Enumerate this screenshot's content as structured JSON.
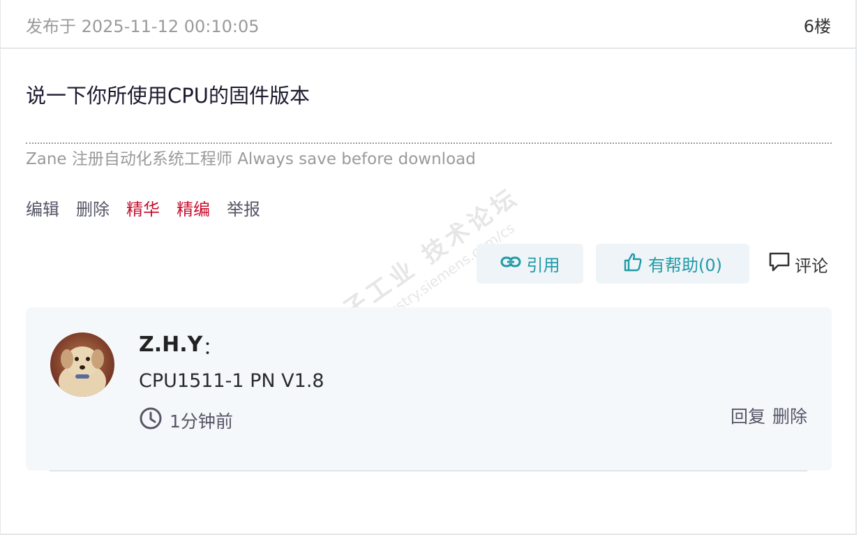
{
  "header": {
    "post_time": "发布于 2025-11-12 00:10:05",
    "floor": "6楼"
  },
  "post": {
    "body": "说一下你所使用CPU的固件版本",
    "signature": "Zane 注册自动化系统工程师 Always save before download"
  },
  "admin_actions": {
    "edit": "编辑",
    "delete": "删除",
    "featured": "精华",
    "edited_pick": "精编",
    "report": "举报"
  },
  "buttons": {
    "quote": "引用",
    "helpful": "有帮助(0)",
    "comment": "评论"
  },
  "comment": {
    "author": "Z.H.Y",
    "colon": "：",
    "text": "CPU1511-1 PN V1.8",
    "time": "1分钟前",
    "reply": "回复",
    "delete": "删除"
  },
  "watermark": {
    "line1": "西门子工业 技术论坛",
    "line2": "support.industry.siemens.com/cs"
  },
  "colors": {
    "accent": "#1f9aa6",
    "red": "#c8102e",
    "muted": "#9a9a9a",
    "button_bg": "#eef4f7",
    "comment_bg": "#f5f8fa"
  },
  "icons": [
    "link-icon",
    "thumbs-up-icon",
    "speech-bubble-icon",
    "clock-icon"
  ]
}
